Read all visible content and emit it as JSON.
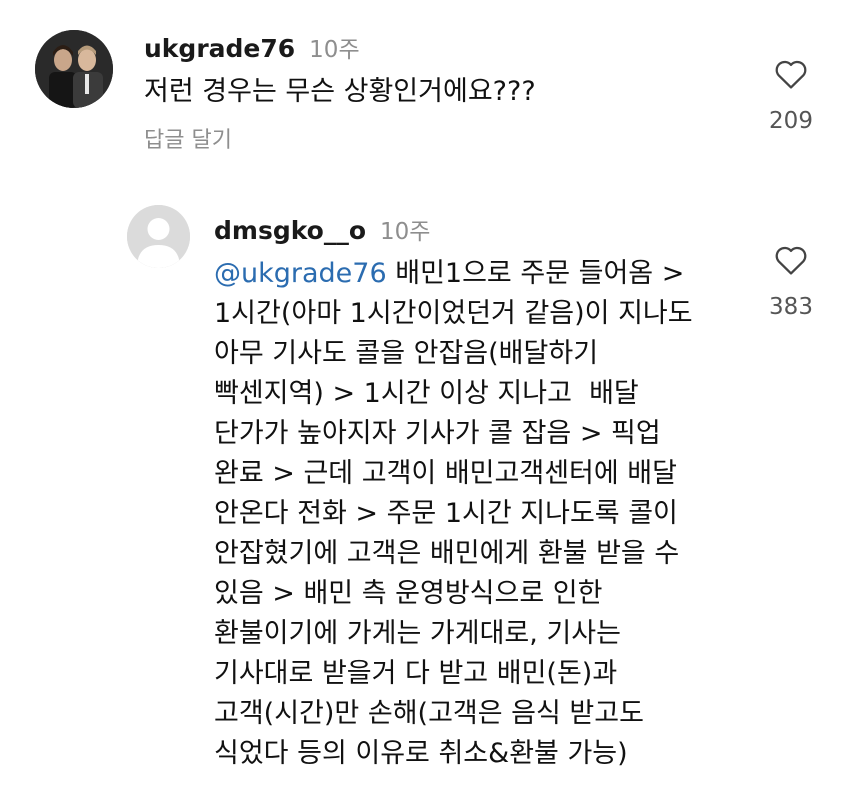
{
  "comment1": {
    "username": "ukgrade76",
    "time": "10주",
    "text": "저런 경우는 무슨 상황인거에요???",
    "reply_label": "답글 달기",
    "like_count": "209",
    "like_icon": "heart-outline-icon"
  },
  "comment2": {
    "username": "dmsgko__o",
    "time": "10주",
    "mention": "@ukgrade76",
    "lines": [
      "배민1으로 주문 들어옴 >",
      "1시간(아마 1시간이었던거 같음)이 지나도",
      "아무 기사도 콜을 안잡음(배달하기",
      "빡센지역) > 1시간 이상 지나고  배달",
      "단가가 높아지자 기사가 콜 잡음 > 픽업",
      "완료 > 근데 고객이 배민고객센터에 배달",
      "안온다 전화 > 주문 1시간 지나도록 콜이",
      "안잡혔기에 고객은 배민에게 환불 받을 수",
      "있음 > 배민 측 운영방식으로 인한",
      "환불이기에 가게는 가게대로, 기사는",
      "기사대로 받을거 다 받고 배민(돈)과",
      "고객(시간)만 손해(고객은 음식 받고도",
      "식었다 등의 이유로 취소&환불 가능)"
    ],
    "like_count": "383",
    "like_icon": "heart-outline-icon"
  },
  "colors": {
    "mention": "#2b6cb0",
    "secondary_text": "#8e8e8e",
    "primary_text": "#111111"
  }
}
